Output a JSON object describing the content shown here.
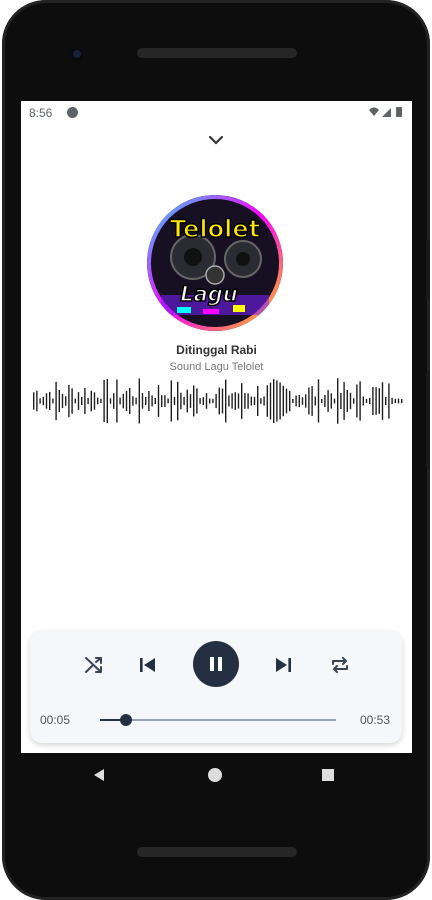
{
  "status_bar": {
    "time": "8:56"
  },
  "art": {
    "line1": "Telolet",
    "line2": "Lagu"
  },
  "song": {
    "title": "Ditinggal Rabi",
    "artist": "Sound Lagu Telolet"
  },
  "player": {
    "elapsed": "00:05",
    "duration": "00:53",
    "progress": 0.109,
    "state": "playing"
  },
  "icons": [
    "collapse-chevron-icon",
    "shuffle-icon",
    "skip-previous-icon",
    "pause-icon",
    "skip-next-icon",
    "repeat-icon",
    "nav-back-icon",
    "nav-home-icon",
    "nav-recents-icon"
  ],
  "colors": {
    "accent": "#243042",
    "waveform": "#1f1f1f"
  }
}
